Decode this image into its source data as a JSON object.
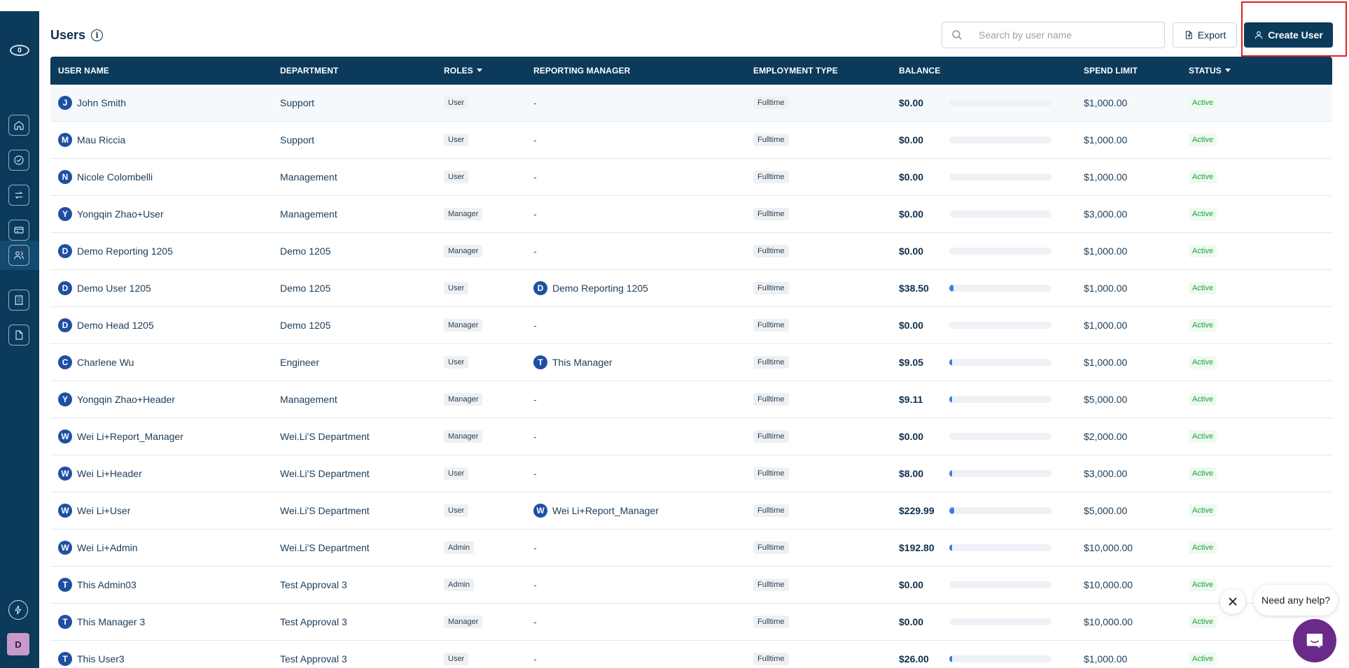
{
  "sidebar": {
    "logo_count": "0",
    "items": [
      {
        "name": "home-icon"
      },
      {
        "name": "check-circle-icon"
      },
      {
        "name": "transfer-icon"
      },
      {
        "name": "card-icon"
      },
      {
        "name": "users-icon",
        "active": true
      },
      {
        "name": "building-icon"
      },
      {
        "name": "document-icon"
      }
    ],
    "avatar_letter": "D"
  },
  "header": {
    "title": "Users",
    "search_placeholder": "Search by user name",
    "export_label": "Export",
    "create_label": "Create User"
  },
  "table": {
    "columns": [
      "USER NAME",
      "DEPARTMENT",
      "ROLES",
      "REPORTING MANAGER",
      "EMPLOYMENT TYPE",
      "BALANCE",
      "SPEND LIMIT",
      "STATUS"
    ],
    "rows": [
      {
        "initial": "J",
        "name": "John Smith",
        "department": "Support",
        "role": "User",
        "manager": "-",
        "manager_initial": "",
        "employment": "Fulltime",
        "balance": "$0.00",
        "usage": 0,
        "limit": "$1,000.00",
        "status": "Active"
      },
      {
        "initial": "M",
        "name": "Mau Riccia",
        "department": "Support",
        "role": "User",
        "manager": "-",
        "manager_initial": "",
        "employment": "Fulltime",
        "balance": "$0.00",
        "usage": 0,
        "limit": "$1,000.00",
        "status": "Active"
      },
      {
        "initial": "N",
        "name": "Nicole Colombelli",
        "department": "Management",
        "role": "User",
        "manager": "-",
        "manager_initial": "",
        "employment": "Fulltime",
        "balance": "$0.00",
        "usage": 0,
        "limit": "$1,000.00",
        "status": "Active"
      },
      {
        "initial": "Y",
        "name": "Yongqin Zhao+User",
        "department": "Management",
        "role": "Manager",
        "manager": "-",
        "manager_initial": "",
        "employment": "Fulltime",
        "balance": "$0.00",
        "usage": 0,
        "limit": "$3,000.00",
        "status": "Active"
      },
      {
        "initial": "D",
        "name": "Demo Reporting 1205",
        "department": "Demo 1205",
        "role": "Manager",
        "manager": "-",
        "manager_initial": "",
        "employment": "Fulltime",
        "balance": "$0.00",
        "usage": 0,
        "limit": "$1,000.00",
        "status": "Active"
      },
      {
        "initial": "D",
        "name": "Demo User 1205",
        "department": "Demo 1205",
        "role": "User",
        "manager": "Demo Reporting 1205",
        "manager_initial": "D",
        "employment": "Fulltime",
        "balance": "$38.50",
        "usage": 0.0385,
        "limit": "$1,000.00",
        "status": "Active"
      },
      {
        "initial": "D",
        "name": "Demo Head 1205",
        "department": "Demo 1205",
        "role": "Manager",
        "manager": "-",
        "manager_initial": "",
        "employment": "Fulltime",
        "balance": "$0.00",
        "usage": 0,
        "limit": "$1,000.00",
        "status": "Active"
      },
      {
        "initial": "C",
        "name": "Charlene Wu",
        "department": "Engineer",
        "role": "User",
        "manager": "This Manager",
        "manager_initial": "T",
        "employment": "Fulltime",
        "balance": "$9.05",
        "usage": 0.009,
        "limit": "$1,000.00",
        "status": "Active"
      },
      {
        "initial": "Y",
        "name": "Yongqin Zhao+Header",
        "department": "Management",
        "role": "Manager",
        "manager": "-",
        "manager_initial": "",
        "employment": "Fulltime",
        "balance": "$9.11",
        "usage": 0.0018,
        "limit": "$5,000.00",
        "status": "Active"
      },
      {
        "initial": "W",
        "name": "Wei Li+Report_Manager",
        "department": "Wei.Li'S Department",
        "role": "Manager",
        "manager": "-",
        "manager_initial": "",
        "employment": "Fulltime",
        "balance": "$0.00",
        "usage": 0,
        "limit": "$2,000.00",
        "status": "Active"
      },
      {
        "initial": "W",
        "name": "Wei Li+Header",
        "department": "Wei.Li'S Department",
        "role": "User",
        "manager": "-",
        "manager_initial": "",
        "employment": "Fulltime",
        "balance": "$8.00",
        "usage": 0.0027,
        "limit": "$3,000.00",
        "status": "Active"
      },
      {
        "initial": "W",
        "name": "Wei Li+User",
        "department": "Wei.Li'S Department",
        "role": "User",
        "manager": "Wei Li+Report_Manager",
        "manager_initial": "W",
        "employment": "Fulltime",
        "balance": "$229.99",
        "usage": 0.046,
        "limit": "$5,000.00",
        "status": "Active"
      },
      {
        "initial": "W",
        "name": "Wei Li+Admin",
        "department": "Wei.Li'S Department",
        "role": "Admin",
        "manager": "-",
        "manager_initial": "",
        "employment": "Fulltime",
        "balance": "$192.80",
        "usage": 0.0193,
        "limit": "$10,000.00",
        "status": "Active"
      },
      {
        "initial": "T",
        "name": "This Admin03",
        "department": "Test Approval 3",
        "role": "Admin",
        "manager": "-",
        "manager_initial": "",
        "employment": "Fulltime",
        "balance": "$0.00",
        "usage": 0,
        "limit": "$10,000.00",
        "status": "Active"
      },
      {
        "initial": "T",
        "name": "This Manager 3",
        "department": "Test Approval 3",
        "role": "Manager",
        "manager": "-",
        "manager_initial": "",
        "employment": "Fulltime",
        "balance": "$0.00",
        "usage": 0,
        "limit": "$10,000.00",
        "status": "Active"
      },
      {
        "initial": "T",
        "name": "This User3",
        "department": "Test Approval 3",
        "role": "User",
        "manager": "-",
        "manager_initial": "",
        "employment": "Fulltime",
        "balance": "$26.00",
        "usage": 0.026,
        "limit": "$1,000.00",
        "status": "Active"
      }
    ]
  },
  "help": {
    "bubble_text": "Need any help?"
  },
  "colors": {
    "brand_navy": "#0b3a5b",
    "avatar_blue": "#1f4fa3",
    "status_green": "#1e9e3a",
    "help_purple": "#6a2a8a",
    "highlight_red": "#e02020"
  }
}
